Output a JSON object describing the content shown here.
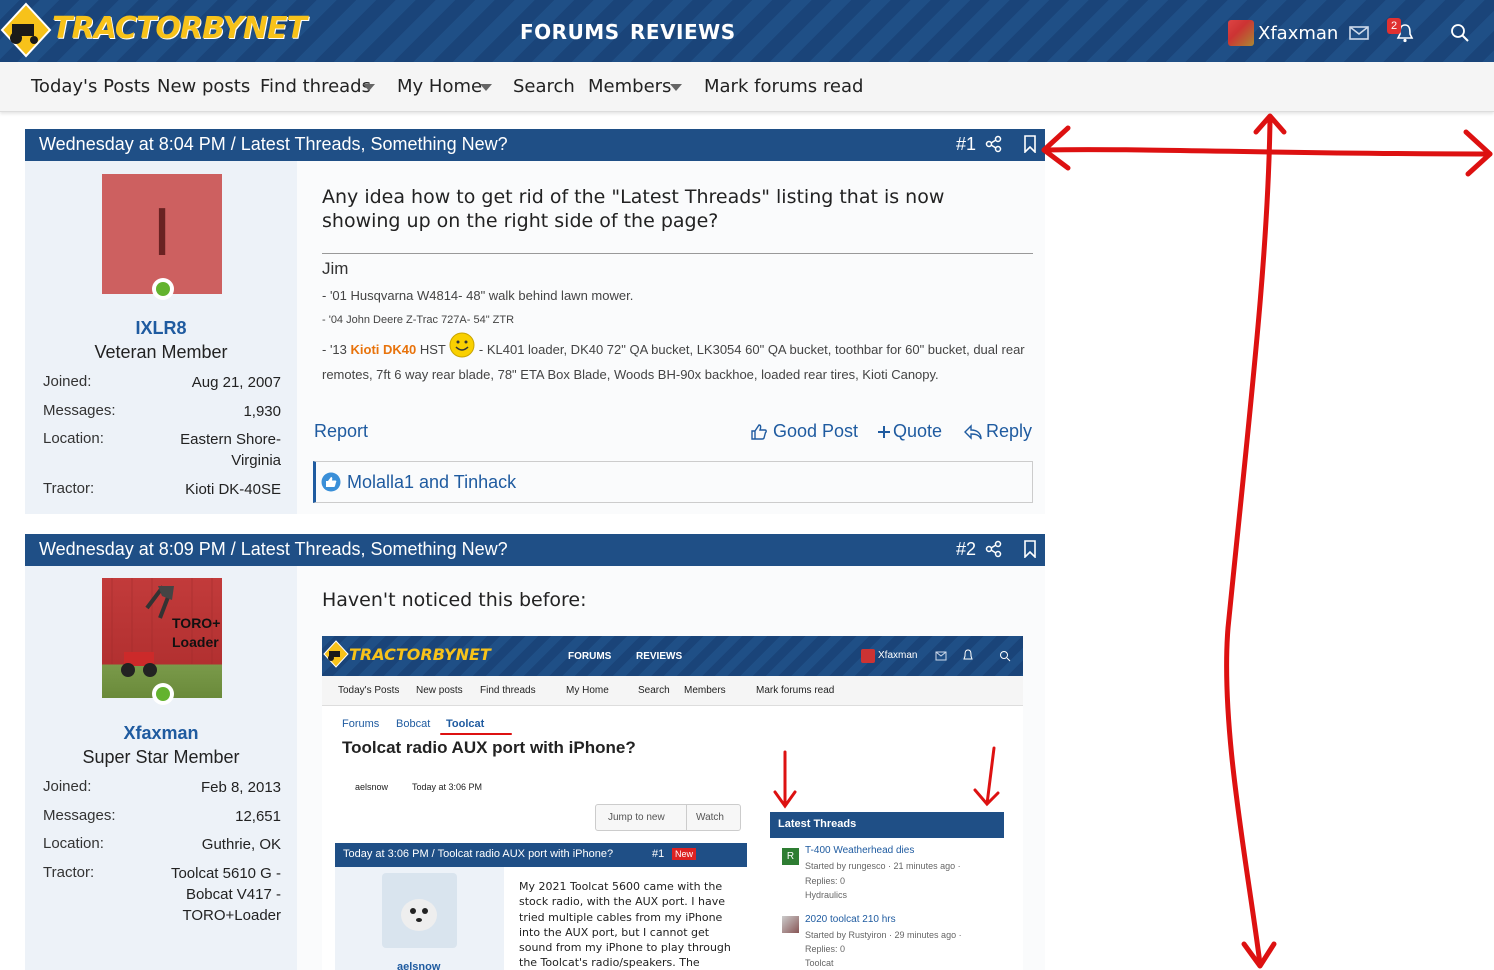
{
  "header": {
    "logo_text": "TRACTORBYNET",
    "nav": [
      "FORUMS",
      "REVIEWS"
    ],
    "username": "Xfaxman",
    "notification_count": "2"
  },
  "subnav": {
    "items": [
      "Today's Posts",
      "New posts",
      "Find threads",
      "My Home",
      "Search",
      "Members",
      "Mark forums read"
    ]
  },
  "posts": [
    {
      "header": "Wednesday at 8:04 PM / Latest Threads, Something New?",
      "number": "#1",
      "avatar_letter": "I",
      "username": "IXLR8",
      "user_title": "Veteran Member",
      "info": [
        {
          "k": "Joined:",
          "v": "Aug 21, 2007"
        },
        {
          "k": "Messages:",
          "v": "1,930"
        },
        {
          "k": "Location:",
          "v": "Eastern Shore-Virginia"
        },
        {
          "k": "Tractor:",
          "v": "Kioti DK-40SE"
        }
      ],
      "body": "Any idea how to get rid of the \"Latest Threads\" listing that is now showing up on the right side of the page?",
      "signature": {
        "name": "Jim",
        "line1": "- '01 Husqvarna W4814- 48\" walk behind lawn mower.",
        "line2": "- '04 John Deere Z-Trac 727A- 54\" ZTR",
        "line3_pre": "- '13",
        "line3_link": "Kioti DK40",
        "line3_mid": "HST",
        "line3_post": "- KL401 loader, DK40 72\" QA bucket, LK3054 60\" QA bucket, toothbar for 60\" bucket, dual rear remotes, 7ft 6 way rear blade, 78\" ETA Box Blade, Woods BH-90x backhoe, loaded rear tires, Kioti Canopy."
      },
      "actions": {
        "report": "Report",
        "good_post": "Good Post",
        "quote": "Quote",
        "reply": "Reply"
      },
      "reactions": "Molalla1 and Tinhack"
    },
    {
      "header": "Wednesday at 8:09 PM / Latest Threads, Something New?",
      "number": "#2",
      "avatar_caption": "TORO+ Loader",
      "username": "Xfaxman",
      "user_title": "Super Star Member",
      "info": [
        {
          "k": "Joined:",
          "v": "Feb 8, 2013"
        },
        {
          "k": "Messages:",
          "v": "12,651"
        },
        {
          "k": "Location:",
          "v": "Guthrie, OK"
        },
        {
          "k": "Tractor:",
          "v": "Toolcat 5610 G - Bobcat V417 - TORO+Loader"
        }
      ],
      "body": "Haven't noticed this before:"
    }
  ],
  "embedded": {
    "logo_text": "TRACTORBYNET",
    "nav": [
      "FORUMS",
      "REVIEWS"
    ],
    "username": "Xfaxman",
    "subnav": [
      "Today's Posts",
      "New posts",
      "Find threads",
      "My Home",
      "Search",
      "Members",
      "Mark forums read"
    ],
    "breadcrumb": [
      "Forums",
      "Bobcat",
      "Toolcat"
    ],
    "title": "Toolcat radio AUX port with iPhone?",
    "meta_user": "aelsnow",
    "meta_time": "Today at 3:06 PM",
    "btn_jump": "Jump to new",
    "btn_watch": "Watch",
    "post_header": "Today at 3:06 PM / Toolcat radio AUX port with iPhone?",
    "post_number": "#1",
    "post_new": "New",
    "post_user": "aelsnow",
    "post_body": "My 2021 Toolcat 5600 came with the stock radio, with the AUX port. I have tried multiple cables from my iPhone into the AUX port, but I cannot get sound from my iPhone to play through the Toolcat's radio/speakers. The",
    "latest_title": "Latest Threads",
    "latest": [
      {
        "icon": "R",
        "title": "T-400 Weatherhead dies",
        "meta": "Started by rungesco · 21 minutes ago ·",
        "replies": "Replies: 0",
        "forum": "Hydraulics"
      },
      {
        "icon": "",
        "title": "2020 toolcat 210 hrs",
        "meta": "Started by Rustyiron · 29 minutes ago ·",
        "replies": "Replies: 0",
        "forum": "Toolcat"
      }
    ]
  }
}
